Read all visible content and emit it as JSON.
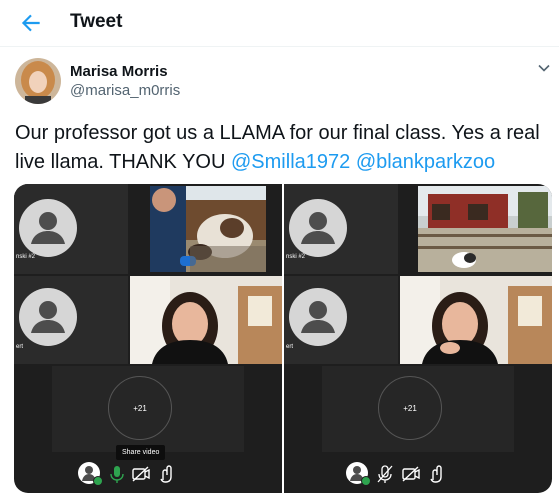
{
  "header": {
    "title": "Tweet"
  },
  "tweet": {
    "author_name": "Marisa Morris",
    "handle": "@marisa_m0rris",
    "text_part1": "Our professor got us a LLAMA for our final class. Yes a real live llama. THANK YOU ",
    "mention1": "@Smilla1972",
    "text_part2": " ",
    "mention2": "@blankparkzoo"
  },
  "media": {
    "panels": [
      {
        "tile_labels": [
          "nski #2",
          "ert"
        ],
        "participant_count": "+21",
        "tooltip": "Share video"
      },
      {
        "tile_labels": [
          "nski #2",
          "ert"
        ],
        "participant_count": "+21"
      }
    ]
  },
  "colors": {
    "accent": "#1d9bf0",
    "meeting_bg": "#1e1e1e",
    "tile_bg": "#2b2b2b",
    "status_green": "#2ea44f"
  },
  "icons": [
    "back-arrow-icon",
    "chevron-down-icon",
    "person-placeholder-icon",
    "microphone-icon",
    "camera-off-icon",
    "reactions-icon"
  ]
}
